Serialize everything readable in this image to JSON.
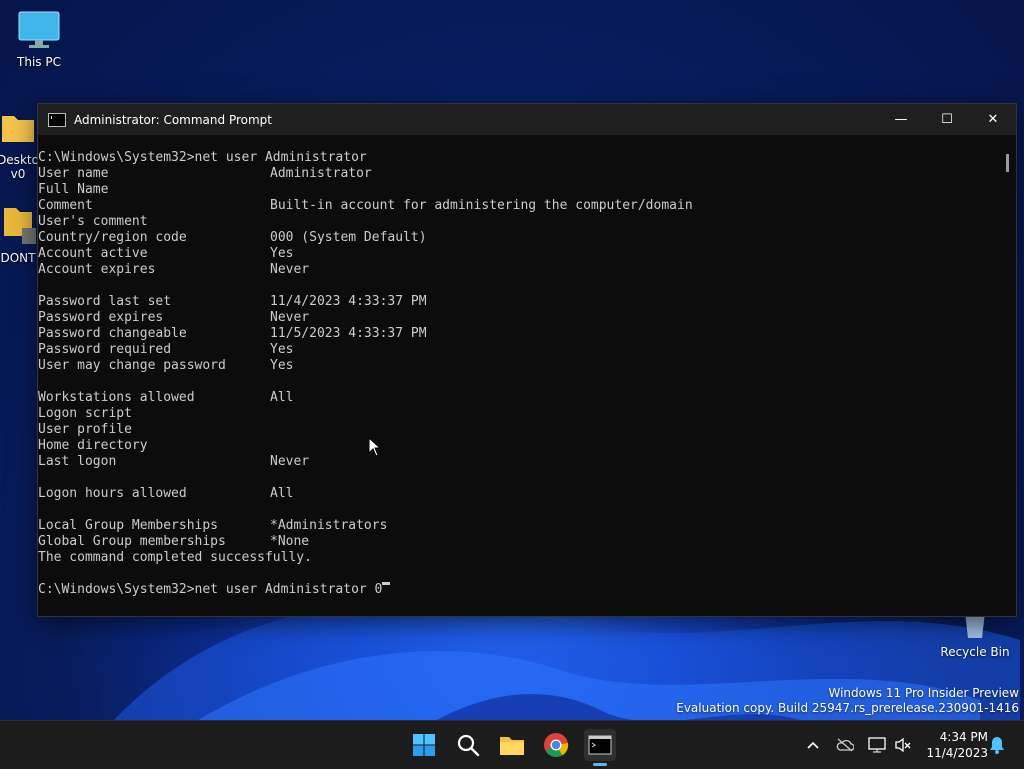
{
  "desktop": {
    "icons": [
      {
        "label": "This PC"
      },
      {
        "label": "Deskto v0"
      },
      {
        "label": "DONT"
      },
      {
        "label": "Recycle Bin"
      }
    ]
  },
  "window": {
    "title": "Administrator: Command Prompt",
    "controls": {
      "minimize": "—",
      "maximize": "☐",
      "close": "✕"
    }
  },
  "console": {
    "command": "C:\\Windows\\System32>net user Administrator",
    "rows": [
      {
        "key": "User name",
        "value": "Administrator"
      },
      {
        "key": "Full Name",
        "value": ""
      },
      {
        "key": "Comment",
        "value": "Built-in account for administering the computer/domain"
      },
      {
        "key": "User's comment",
        "value": ""
      },
      {
        "key": "Country/region code",
        "value": "000 (System Default)"
      },
      {
        "key": "Account active",
        "value": "Yes"
      },
      {
        "key": "Account expires",
        "value": "Never"
      },
      {
        "key": "",
        "value": ""
      },
      {
        "key": "Password last set",
        "value": "11/4/2023 4:33:37 PM"
      },
      {
        "key": "Password expires",
        "value": "Never"
      },
      {
        "key": "Password changeable",
        "value": "11/5/2023 4:33:37 PM"
      },
      {
        "key": "Password required",
        "value": "Yes"
      },
      {
        "key": "User may change password",
        "value": "Yes"
      },
      {
        "key": "",
        "value": ""
      },
      {
        "key": "Workstations allowed",
        "value": "All"
      },
      {
        "key": "Logon script",
        "value": ""
      },
      {
        "key": "User profile",
        "value": ""
      },
      {
        "key": "Home directory",
        "value": ""
      },
      {
        "key": "Last logon",
        "value": "Never"
      },
      {
        "key": "",
        "value": ""
      },
      {
        "key": "Logon hours allowed",
        "value": "All"
      },
      {
        "key": "",
        "value": ""
      },
      {
        "key": "Local Group Memberships",
        "value": "*Administrators"
      },
      {
        "key": "Global Group memberships",
        "value": "*None"
      }
    ],
    "completed": "The command completed successfully.",
    "prompt_line": "C:\\Windows\\System32>net user Administrator 0"
  },
  "watermark": {
    "line1": "Windows 11 Pro Insider Preview",
    "line2": "Evaluation copy. Build 25947.rs_prerelease.230901-1416"
  },
  "taskbar": {
    "items": [
      "start-icon",
      "search-icon",
      "file-explorer-icon",
      "chrome-icon",
      "terminal-icon"
    ],
    "tray": [
      "chevron-up-icon",
      "onedrive-icon",
      "network-icon",
      "volume-muted-icon",
      "notification-bell-icon"
    ],
    "clock": {
      "time": "4:34 PM",
      "date": "11/4/2023"
    }
  },
  "colors": {
    "console_bg": "#0c0c0c",
    "console_text": "#cccccc",
    "taskbar_bg": "#1c1c1c",
    "accent": "#5fb2f2"
  }
}
